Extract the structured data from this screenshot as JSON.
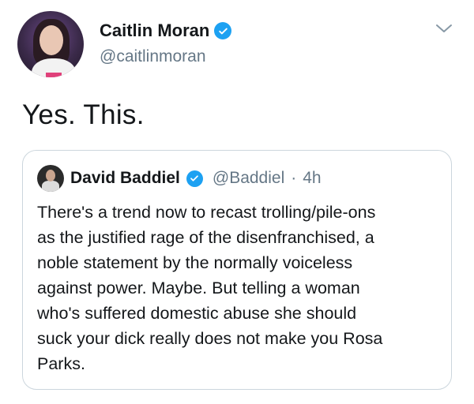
{
  "tweet": {
    "author_name": "Caitlin Moran",
    "author_handle": "@caitlinmoran",
    "text": "Yes. This."
  },
  "quoted": {
    "author_name": "David Baddiel",
    "author_handle": "@Baddiel",
    "separator": "·",
    "time": "4h",
    "lines": [
      "There's a trend now to recast trolling/pile-ons",
      "as the justified rage of the disenfranchised, a",
      "noble statement by the normally voiceless",
      "against power. Maybe. But telling a woman",
      "who's suffered domestic abuse she should",
      "suck your dick really does not make you Rosa",
      "Parks."
    ]
  },
  "icons": {
    "verified": "verified-badge-icon",
    "menu": "chevron-down-icon"
  },
  "colors": {
    "verified": "#1da1f2",
    "secondary_text": "#657786",
    "primary_text": "#14171a",
    "border": "#ccd6dd"
  }
}
